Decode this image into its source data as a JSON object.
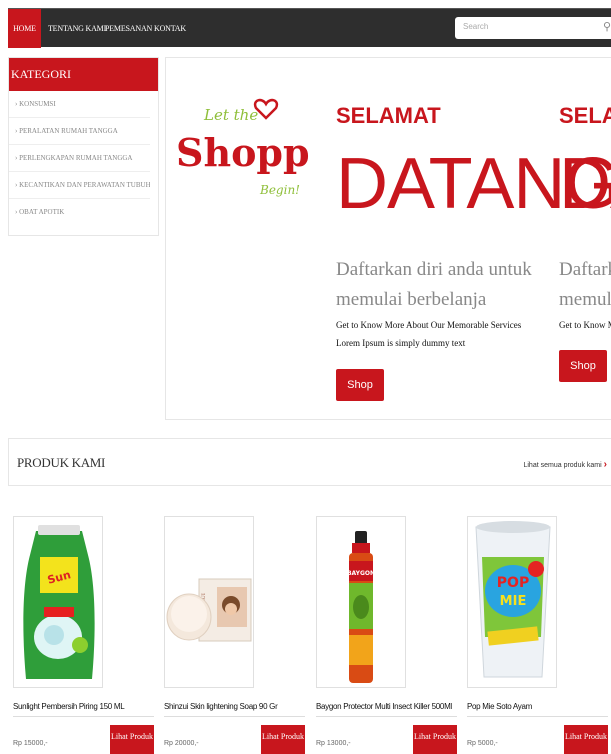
{
  "nav": {
    "items": [
      "HOME",
      "TENTANG KAMI",
      "PEMESANAN",
      "KONTAK"
    ],
    "search_placeholder": "Search"
  },
  "sidebar": {
    "title": "KATEGORI",
    "items": [
      "KONSUMSI",
      "PERALATAN RUMAH TANGGA",
      "PERLENGKAPAN RUMAH TANGGA",
      "KECANTIKAN DAN PERAWATAN TUBUH",
      "OBAT APOTIK"
    ]
  },
  "hero": {
    "logo_script_top": "Let the",
    "logo_main": "Shopping",
    "logo_script_bottom": "Begin!",
    "slide1": {
      "heading_small": "SELAMAT",
      "heading_big": "DATANG",
      "tagline_1": "Daftarkan diri anda untuk",
      "tagline_2": "memulai berbelanja",
      "text_1": "Get to Know More About Our Memorable Services",
      "text_2": "Lorem Ipsum is simply dummy text",
      "button": "Shop Now"
    },
    "slide2": {
      "heading_small": "SELAM",
      "heading_big": "DA",
      "tagline_1": "Daftarkan",
      "tagline_2": "memulai b",
      "text_1": "Get to Know Mo",
      "button": "Shop Now"
    }
  },
  "produk": {
    "title": "PRODUK KAMI",
    "see_all": "Lihat semua produk kami",
    "items": [
      {
        "name": "Sunlight Pembersih Piring 150 ML",
        "price": "Rp 15000,-",
        "button": "Lihat Produk"
      },
      {
        "name": "Shinzui Skin lightening Soap 90 Gr",
        "price": "Rp 20000,-",
        "button": "Lihat Produk"
      },
      {
        "name": "Baygon Protector Multi Insect Killer 500Ml",
        "price": "Rp 13000,-",
        "button": "Lihat Produk"
      },
      {
        "name": "Pop Mie Soto Ayam",
        "price": "Rp 5000,-",
        "button": "Lihat Produk"
      }
    ]
  },
  "colors": {
    "accent": "#c8161d",
    "nav_bg": "#2e2e2e"
  }
}
